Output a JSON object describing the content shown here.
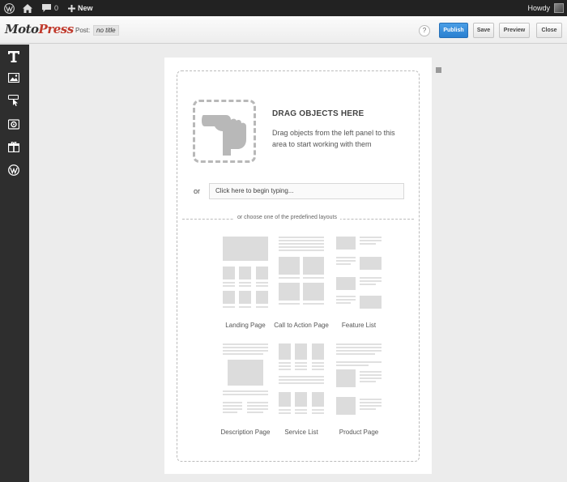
{
  "adminbar": {
    "comment_count": "0",
    "new_label": "New",
    "howdy_label": "Howdy"
  },
  "topbar": {
    "logo_part1": "Moto",
    "logo_part2": "Press",
    "post_label": "Post:",
    "post_title": "no title",
    "help_label": "?",
    "publish_label": "Publish",
    "save_label": "Save",
    "preview_label": "Preview",
    "close_label": "Close"
  },
  "sidebar": {
    "items": [
      {
        "icon": "text-icon"
      },
      {
        "icon": "image-icon"
      },
      {
        "icon": "button-icon"
      },
      {
        "icon": "video-icon"
      },
      {
        "icon": "widget-icon"
      },
      {
        "icon": "wordpress-icon"
      }
    ]
  },
  "canvas": {
    "drag_title": "DRAG OBJECTS HERE",
    "drag_desc": "Drag objects from the left panel to this area to start working with them",
    "or_label": "or",
    "type_placeholder": "Click here to begin typing...",
    "divider_label": "or choose one of the predefined layouts"
  },
  "layouts": [
    {
      "name": "Landing Page"
    },
    {
      "name": "Call to Action Page"
    },
    {
      "name": "Feature List"
    },
    {
      "name": "Description Page"
    },
    {
      "name": "Service List"
    },
    {
      "name": "Product Page"
    }
  ],
  "colors": {
    "accent": "#2a7fd0",
    "logo_red": "#c0392b",
    "sidebar": "#2e2e2e",
    "adminbar": "#222222"
  }
}
